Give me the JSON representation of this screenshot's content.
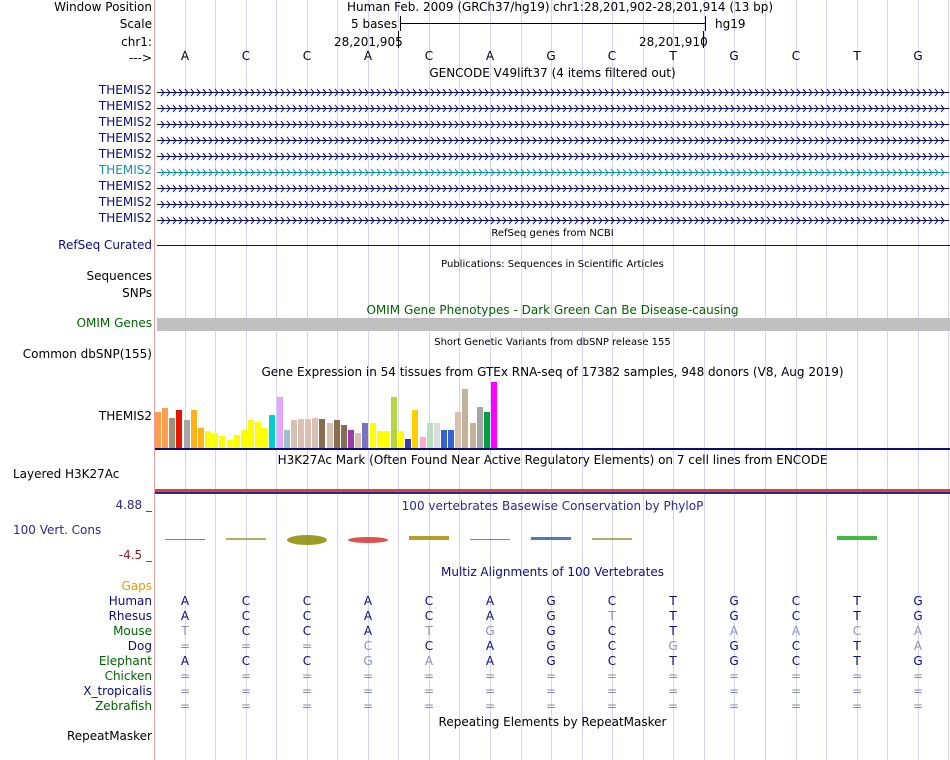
{
  "header_labels": {
    "window_position": "Window Position",
    "scale": "Scale",
    "chrom": "chr1:",
    "arrow": "--->"
  },
  "position": {
    "assembly": "Human Feb. 2009 (GRCh37/hg19)",
    "range": "chr1:28,201,902-28,201,914 (13 bp)",
    "scale_text": "5 bases",
    "db": "hg19",
    "coord_left": "28,201,905",
    "coord_right": "28,201,910"
  },
  "bases": [
    "A",
    "C",
    "C",
    "A",
    "C",
    "A",
    "G",
    "C",
    "T",
    "G",
    "C",
    "T",
    "G"
  ],
  "gencode": {
    "title": "GENCODE V49lift37 (4 items filtered out)",
    "items": [
      {
        "label": "THEMIS2",
        "color": "#0c0c78"
      },
      {
        "label": "THEMIS2",
        "color": "#0c0c78"
      },
      {
        "label": "THEMIS2",
        "color": "#0c0c78"
      },
      {
        "label": "THEMIS2",
        "color": "#0c0c78"
      },
      {
        "label": "THEMIS2",
        "color": "#0c0c78"
      },
      {
        "label": "THEMIS2",
        "color": "#118da7"
      },
      {
        "label": "THEMIS2",
        "color": "#0c0c78"
      },
      {
        "label": "THEMIS2",
        "color": "#0c0c78"
      },
      {
        "label": "THEMIS2",
        "color": "#0c0c78"
      }
    ]
  },
  "refseq": {
    "title": "RefSeq genes from NCBI",
    "label": "RefSeq Curated"
  },
  "publications": {
    "title": "Publications: Sequences in Scientific Articles",
    "label_sequences": "Sequences",
    "label_snps": "SNPs"
  },
  "omim": {
    "title": "OMIM Gene Phenotypes - Dark Green Can Be Disease-causing",
    "label": "OMIM Genes"
  },
  "dbsnp": {
    "title": "Short Genetic Variants from dbSNP release 155",
    "label": "Common dbSNP(155)"
  },
  "gtex": {
    "title": "Gene Expression in 54 tissues from GTEx RNA-seq of 17382 samples, 948 donors (V8, Aug 2019)",
    "label": "THEMIS2",
    "colors": [
      "#ff9d4c",
      "#ff9d4c",
      "#a58e74",
      "#e51600",
      "#a6a6a6",
      "#ffb21a",
      "#ffb21a",
      "#ffff00",
      "#ffff00",
      "#ffff00",
      "#ffff00",
      "#ffff00",
      "#ffff00",
      "#ffff00",
      "#ffff00",
      "#ffff00",
      "#00d0d0",
      "#e8a3ff",
      "#9ac0d0",
      "#d9c0b0",
      "#d9c0b0",
      "#d9c0b0",
      "#d9c0b0",
      "#8a6d4e",
      "#d9c0b0",
      "#8a6d4e",
      "#8a6d4e",
      "#9b3aa8",
      "#d9c0b0",
      "#7c72c6",
      "#ffff00",
      "#ffff00",
      "#ffff00",
      "#b5d640",
      "#ffff00",
      "#3a3aa8",
      "#ffd000",
      "#ffa7cc",
      "#b8e0c0",
      "#dcdcdc",
      "#3563d0",
      "#3563d0",
      "#d9c0b0",
      "#c6b29a",
      "#c6b29a",
      "#a6a6a6",
      "#00a040",
      "#ff00ff"
    ],
    "values": [
      0.55,
      0.6,
      0.45,
      0.58,
      0.42,
      0.58,
      0.3,
      0.25,
      0.22,
      0.18,
      0.12,
      0.2,
      0.28,
      0.42,
      0.4,
      0.3,
      0.5,
      0.78,
      0.28,
      0.42,
      0.44,
      0.44,
      0.46,
      0.44,
      0.38,
      0.42,
      0.35,
      0.27,
      0.22,
      0.38,
      0.38,
      0.26,
      0.26,
      0.78,
      0.26,
      0.14,
      0.58,
      0.16,
      0.38,
      0.38,
      0.28,
      0.28,
      0.55,
      0.9,
      0.38,
      0.62,
      0.55,
      1.0
    ]
  },
  "h3k27ac": {
    "title": "H3K27Ac Mark (Often Found Near Active Regulatory Elements) on 7 cell lines from ENCODE",
    "label": "Layered H3K27Ac"
  },
  "phylop": {
    "title": "100 vertebrates Basewise Conservation by PhyloP",
    "label": "100 Vert. Cons",
    "max": "4.88 _",
    "min": "-4.5 _"
  },
  "multiz": {
    "title": "Multiz Alignments of 100 Vertebrates",
    "gaps_label": "Gaps",
    "species": [
      {
        "name": "Human",
        "color": "#0c0c78",
        "bases": [
          "A",
          "C",
          "C",
          "A",
          "C",
          "A",
          "G",
          "C",
          "T",
          "G",
          "C",
          "T",
          "G"
        ]
      },
      {
        "name": "Rhesus",
        "color": "#0c0c78",
        "bases": [
          "A",
          "C",
          "C",
          "A",
          "C",
          "A",
          "G",
          "T",
          "T",
          "G",
          "C",
          "T",
          "G"
        ]
      },
      {
        "name": "Mouse",
        "color": "#006400",
        "bases": [
          "T",
          "C",
          "C",
          "A",
          "T",
          "G",
          "G",
          "C",
          "T",
          "A",
          "A",
          "C",
          "A"
        ]
      },
      {
        "name": "Dog",
        "color": "#0c0c78",
        "bases": [
          "=",
          "=",
          "=",
          "C",
          "C",
          "A",
          "G",
          "C",
          "G",
          "G",
          "C",
          "T",
          "A"
        ]
      },
      {
        "name": "Elephant",
        "color": "#006400",
        "bases": [
          "A",
          "C",
          "C",
          "G",
          "A",
          "A",
          "G",
          "C",
          "T",
          "G",
          "C",
          "T",
          "G"
        ]
      },
      {
        "name": "Chicken",
        "color": "#006400",
        "bases": [
          "=",
          "=",
          "=",
          "=",
          "=",
          "=",
          "=",
          "=",
          "=",
          "=",
          "=",
          "=",
          "="
        ]
      },
      {
        "name": "X_tropicalis",
        "color": "#0c0c78",
        "bases": [
          "=",
          "=",
          "=",
          "=",
          "=",
          "=",
          "=",
          "=",
          "=",
          "=",
          "=",
          "=",
          "="
        ]
      },
      {
        "name": "Zebrafish",
        "color": "#006400",
        "bases": [
          "=",
          "=",
          "=",
          "=",
          "=",
          "=",
          "=",
          "=",
          "=",
          "=",
          "=",
          "=",
          "="
        ]
      }
    ]
  },
  "repeatmasker": {
    "title": "Repeating Elements by RepeatMasker",
    "label": "RepeatMasker"
  },
  "colors": {
    "track_blue": "#0c0c78",
    "omim_green": "#006400",
    "gaps_orange": "#e5a000",
    "phylop_min": "#8c1c1c",
    "grid": "#d4d4f4",
    "divider": "#e8a0a0"
  }
}
